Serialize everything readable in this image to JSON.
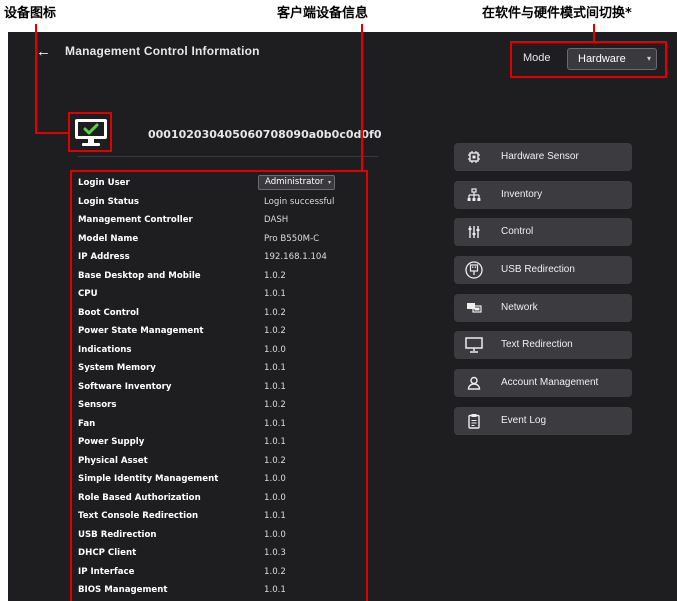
{
  "captions": {
    "device_icon": "设备图标",
    "client_info": "客户端设备信息",
    "mode_switch": "在软件与硬件模式间切换*"
  },
  "header": {
    "back_icon": "arrow-left-icon",
    "title": "Management Control Information"
  },
  "mode": {
    "label": "Mode",
    "value": "Hardware"
  },
  "device": {
    "icon": "monitor-check-icon",
    "id": "000102030405060708090a0b0c0d0f0"
  },
  "info": {
    "login_user": {
      "label": "Login User",
      "value": "Administrator"
    },
    "rows": [
      {
        "key": "Login Status",
        "value": "Login successful"
      },
      {
        "key": "Management Controller",
        "value": "DASH"
      },
      {
        "key": "Model Name",
        "value": "Pro B550M-C"
      },
      {
        "key": "IP Address",
        "value": "192.168.1.104"
      },
      {
        "key": "Base Desktop and Mobile",
        "value": "1.0.2"
      },
      {
        "key": "CPU",
        "value": "1.0.1"
      },
      {
        "key": "Boot Control",
        "value": "1.0.2"
      },
      {
        "key": "Power State Management",
        "value": "1.0.2"
      },
      {
        "key": "Indications",
        "value": "1.0.0"
      },
      {
        "key": "System Memory",
        "value": "1.0.1"
      },
      {
        "key": "Software Inventory",
        "value": "1.0.1"
      },
      {
        "key": "Sensors",
        "value": "1.0.2"
      },
      {
        "key": "Fan",
        "value": "1.0.1"
      },
      {
        "key": "Power Supply",
        "value": "1.0.1"
      },
      {
        "key": "Physical Asset",
        "value": "1.0.2"
      },
      {
        "key": "Simple Identity Management",
        "value": "1.0.0"
      },
      {
        "key": "Role Based Authorization",
        "value": "1.0.0"
      },
      {
        "key": "Text Console Redirection",
        "value": "1.0.1"
      },
      {
        "key": "USB Redirection",
        "value": "1.0.0"
      },
      {
        "key": "DHCP Client",
        "value": "1.0.3"
      },
      {
        "key": "IP Interface",
        "value": "1.0.2"
      },
      {
        "key": "BIOS Management",
        "value": "1.0.1"
      }
    ]
  },
  "menu": [
    {
      "id": "hardware-sensor",
      "label": "Hardware Sensor",
      "icon": "chip-icon"
    },
    {
      "id": "inventory",
      "label": "Inventory",
      "icon": "hierarchy-icon"
    },
    {
      "id": "control",
      "label": "Control",
      "icon": "sliders-icon"
    },
    {
      "id": "usb-redirection",
      "label": "USB Redirection",
      "icon": "usb-icon"
    },
    {
      "id": "network",
      "label": "Network",
      "icon": "network-icon"
    },
    {
      "id": "text-redirection",
      "label": "Text Redirection",
      "icon": "monitor-icon"
    },
    {
      "id": "account-management",
      "label": "Account Management",
      "icon": "user-icon"
    },
    {
      "id": "event-log",
      "label": "Event Log",
      "icon": "clipboard-icon"
    }
  ],
  "colors": {
    "background": "#1e1e20",
    "button": "#3b3b40",
    "highlight": "#e00000",
    "check": "#5bd13a"
  }
}
